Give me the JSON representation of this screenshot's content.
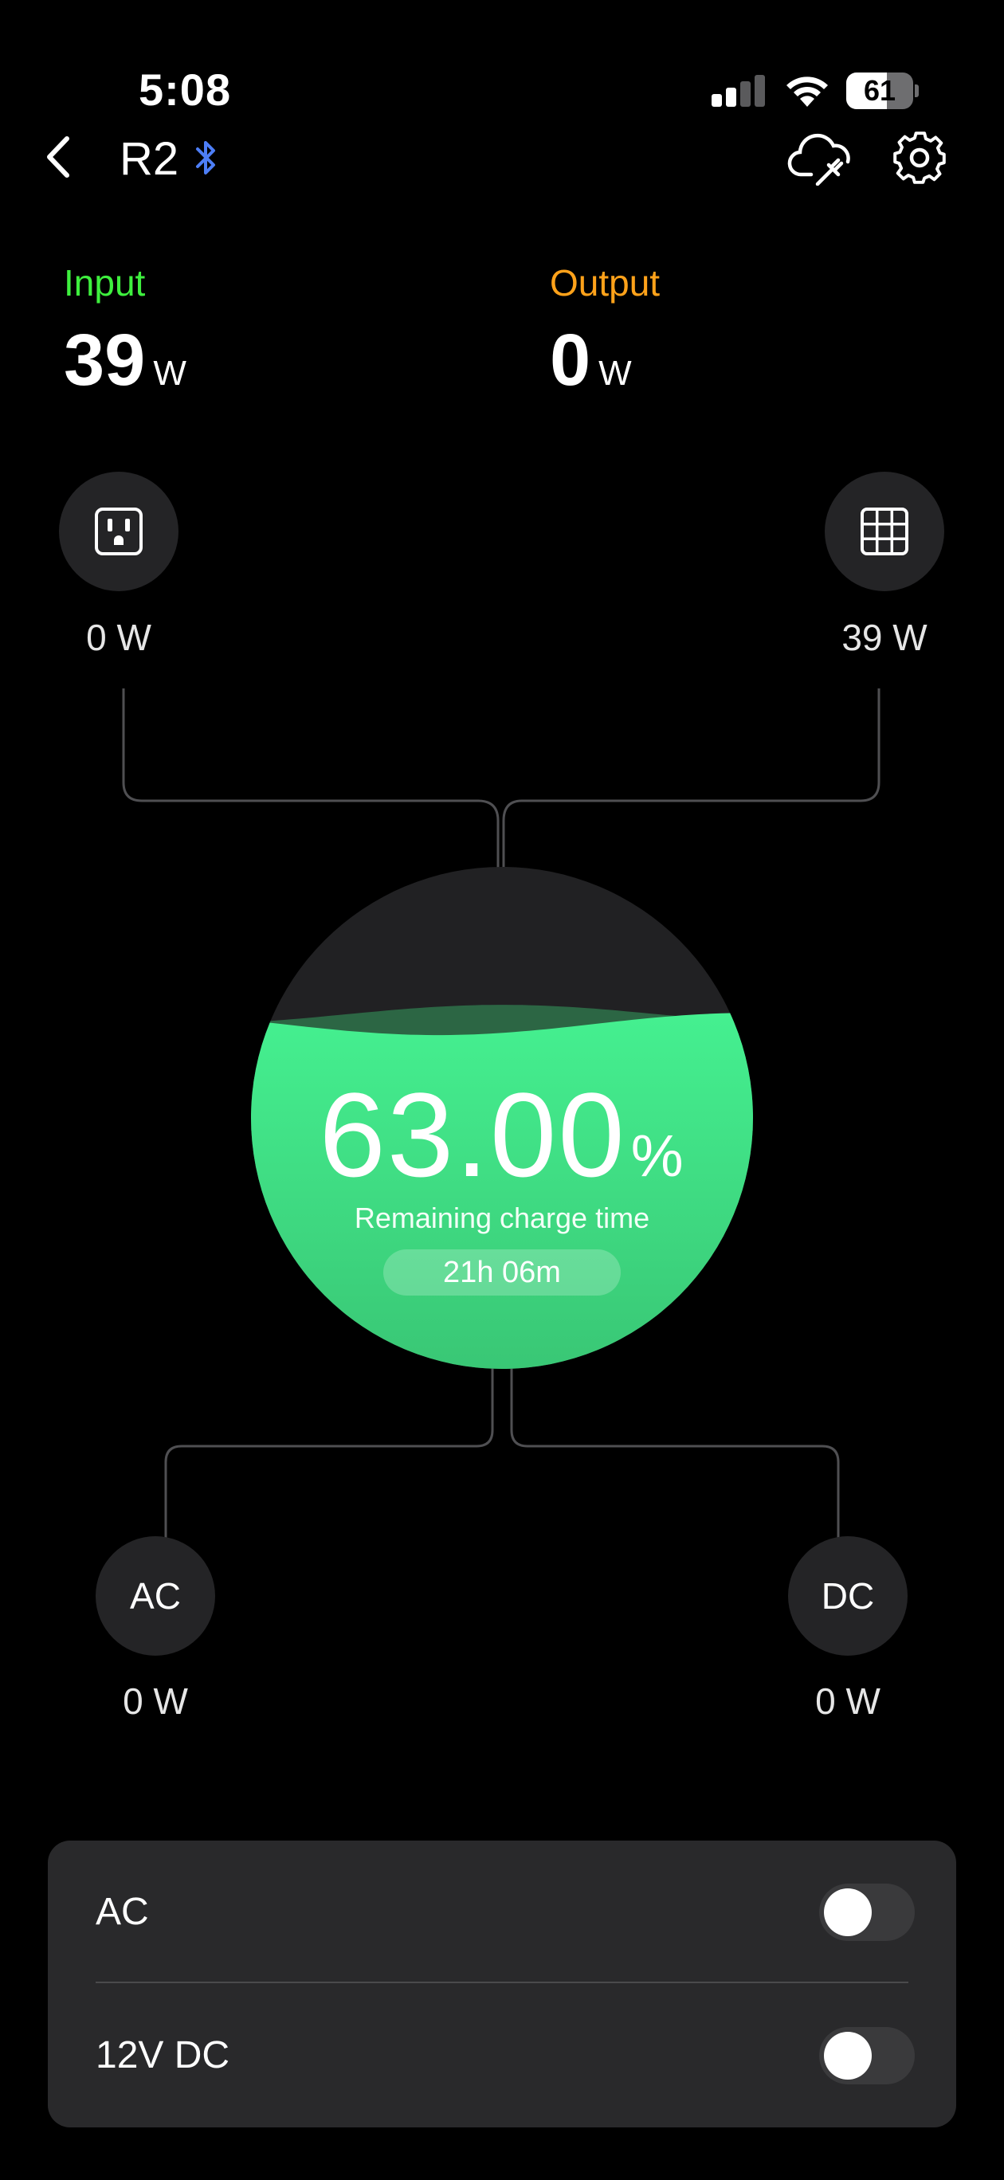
{
  "status_bar": {
    "time": "5:08",
    "battery_percent": "61",
    "battery_level": 0.61
  },
  "nav": {
    "device_name": "R2",
    "icons": [
      "chevron-left-icon",
      "bluetooth-icon",
      "cloud-plug-icon",
      "gear-icon"
    ]
  },
  "summary": {
    "input_label": "Input",
    "input_value": "39",
    "input_unit": "W",
    "output_label": "Output",
    "output_value": "0",
    "output_unit": "W"
  },
  "ports": {
    "grid_input": {
      "icon": "wall-outlet-icon",
      "value": "0 W"
    },
    "solar_input": {
      "icon": "solar-panel-icon",
      "value": "39 W"
    },
    "ac_output": {
      "label": "AC",
      "value": "0 W"
    },
    "dc_output": {
      "label": "DC",
      "value": "0 W"
    }
  },
  "battery": {
    "charge": "63.00",
    "charge_unit": "%",
    "charge_fraction": 0.63,
    "remaining_label": "Remaining charge time",
    "remaining_time": "21h 06m"
  },
  "switches": [
    {
      "label": "AC",
      "on": false
    },
    {
      "label": "12V DC",
      "on": false
    }
  ],
  "colors": {
    "background": "#000000",
    "input_accent": "#3ef03e",
    "output_accent": "#ffa21a",
    "charge_green": "#3ee283",
    "bluetooth_blue": "#4d7ef6",
    "node_bg": "#242426",
    "panel_bg": "#29292b",
    "connector": "#4f4f52"
  }
}
